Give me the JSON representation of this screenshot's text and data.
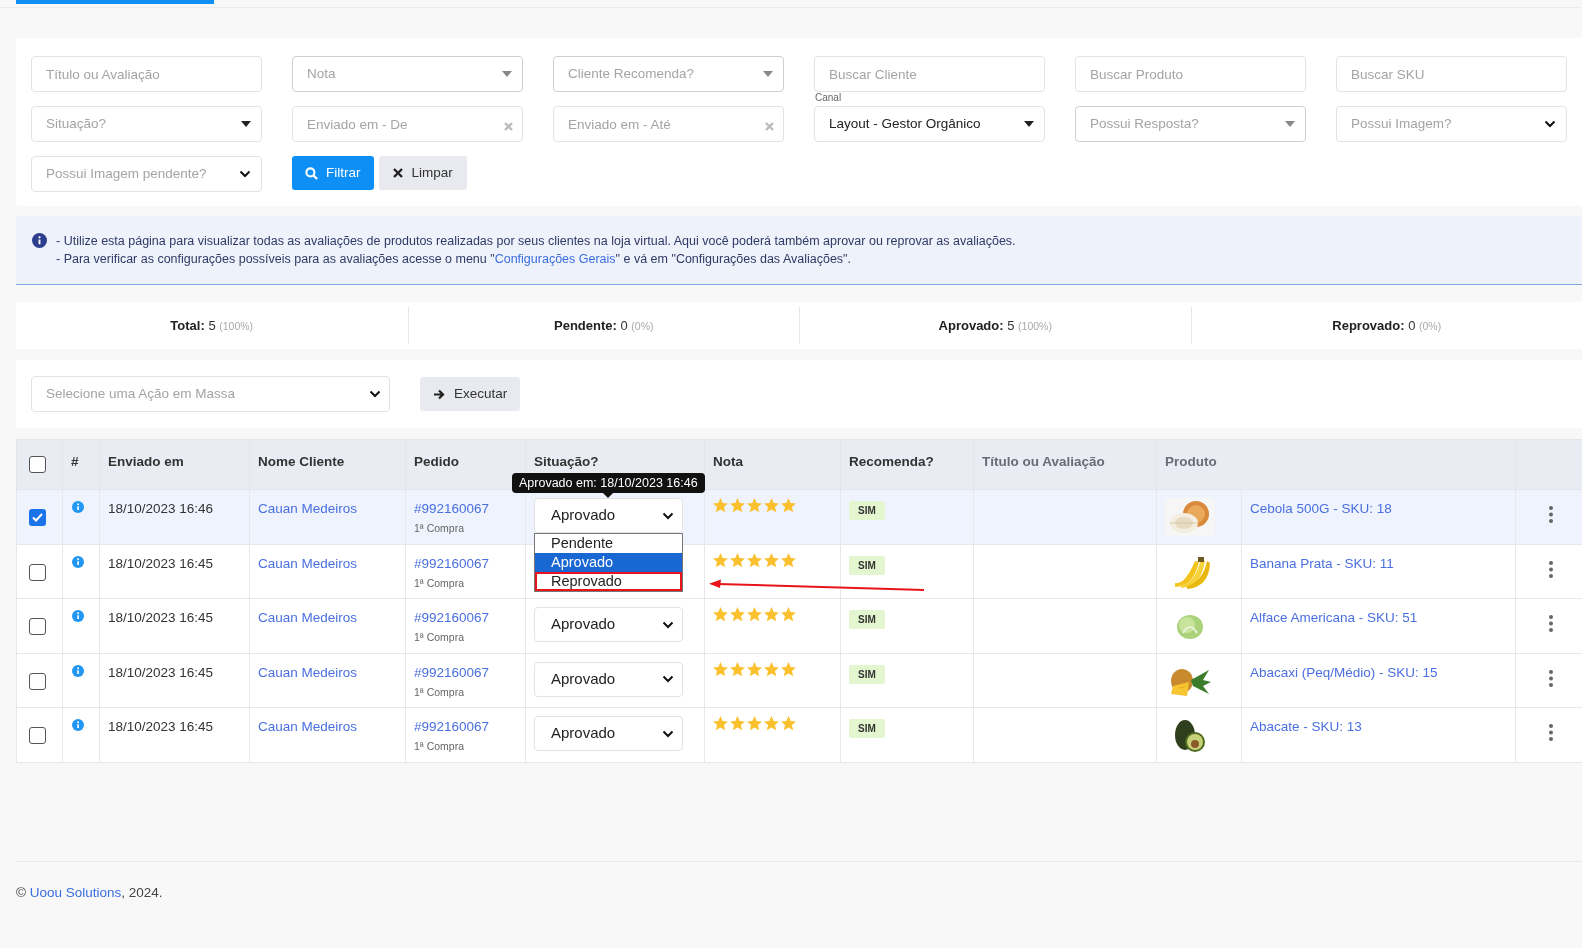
{
  "filters": [
    {
      "kind": "input",
      "placeholder": "Título ou Avaliação"
    },
    {
      "kind": "select-muted",
      "placeholder": "Nota"
    },
    {
      "kind": "select-muted",
      "placeholder": "Cliente Recomenda?"
    },
    {
      "kind": "input",
      "placeholder": "Buscar Cliente"
    },
    {
      "kind": "input",
      "placeholder": "Buscar Produto"
    },
    {
      "kind": "input",
      "placeholder": "Buscar SKU"
    },
    {
      "kind": "select",
      "placeholder": "Situação?"
    },
    {
      "kind": "date",
      "placeholder": "Enviado em - De"
    },
    {
      "kind": "date",
      "placeholder": "Enviado em - Até"
    },
    {
      "kind": "select",
      "label": "Canal",
      "value": "Layout - Gestor Orgânico"
    },
    {
      "kind": "select-muted",
      "placeholder": "Possui Resposta?"
    },
    {
      "kind": "select-native",
      "placeholder": "Possui Imagem?"
    },
    {
      "kind": "select-native",
      "placeholder": "Possui Imagem pendente?"
    }
  ],
  "filter_buttons": [
    {
      "kind": "primary",
      "label": "Filtrar"
    },
    {
      "kind": "secondary",
      "label": "Limpar"
    }
  ],
  "info": [
    [
      {
        "text": "- Utilize esta página para visualizar todas as avaliações de produtos realizadas por seus clientes na loja virtual. Aqui você poderá também aprovar ou reprovar as avaliações."
      }
    ],
    [
      {
        "text": "- Para verificar as configurações possíveis para as avaliações acesse o menu \""
      },
      {
        "text": "Configurações Gerais",
        "link": true
      },
      {
        "text": "\" e vá em \"Configurações das Avaliações\"."
      }
    ]
  ],
  "stats": [
    {
      "label": "Total:",
      "value": "5",
      "percent": "(100%)"
    },
    {
      "label": "Pendente:",
      "value": "0",
      "percent": "(0%)"
    },
    {
      "label": "Aprovado:",
      "value": "5",
      "percent": "(100%)"
    },
    {
      "label": "Reprovado:",
      "value": "0",
      "percent": "(0%)"
    }
  ],
  "bulk_action": {
    "placeholder": "Selecione uma Ação em Massa",
    "button": "Executar"
  },
  "table": {
    "select_all": {
      "checked": false
    },
    "columns": [
      "#",
      "Enviado em",
      "Nome Cliente",
      "Pedido",
      "Situação?",
      "Nota",
      "Recomenda?",
      "Título ou Avaliação",
      "Produto"
    ],
    "rows": [
      {
        "selected": true,
        "sent": "18/10/2023 16:46",
        "client": "Cauan Medeiros",
        "order": "#992160067",
        "order_note": "1ª Compra",
        "status": "Aprovado",
        "stars": 5,
        "recommend": "SIM",
        "product": "Cebola 500G - SKU: 18"
      },
      {
        "selected": false,
        "sent": "18/10/2023 16:45",
        "client": "Cauan Medeiros",
        "order": "#992160067",
        "order_note": "1ª Compra",
        "stars": 5,
        "recommend": "SIM",
        "product": "Banana Prata - SKU: 11"
      },
      {
        "selected": false,
        "sent": "18/10/2023 16:45",
        "client": "Cauan Medeiros",
        "order": "#992160067",
        "order_note": "1ª Compra",
        "status": "Aprovado",
        "stars": 5,
        "recommend": "SIM",
        "product": "Alface Americana - SKU: 51"
      },
      {
        "selected": false,
        "sent": "18/10/2023 16:45",
        "client": "Cauan Medeiros",
        "order": "#992160067",
        "order_note": "1ª Compra",
        "status": "Aprovado",
        "stars": 5,
        "recommend": "SIM",
        "product": "Abacaxi (Peq/Médio) - SKU: 15"
      },
      {
        "selected": false,
        "sent": "18/10/2023 16:45",
        "client": "Cauan Medeiros",
        "order": "#992160067",
        "order_note": "1ª Compra",
        "status": "Aprovado",
        "stars": 5,
        "recommend": "SIM",
        "product": "Abacate - SKU: 13"
      }
    ],
    "tooltip": "Aprovado em: 18/10/2023 16:46",
    "status_menu": [
      {
        "label": "Pendente",
        "selected": false,
        "outlined": false
      },
      {
        "label": "Aprovado",
        "selected": true,
        "outlined": false
      },
      {
        "label": "Reprovado",
        "selected": false,
        "outlined": true
      }
    ]
  },
  "footer": {
    "copyright": "©",
    "link": "Uoou Solutions",
    "text": ", 2024."
  }
}
